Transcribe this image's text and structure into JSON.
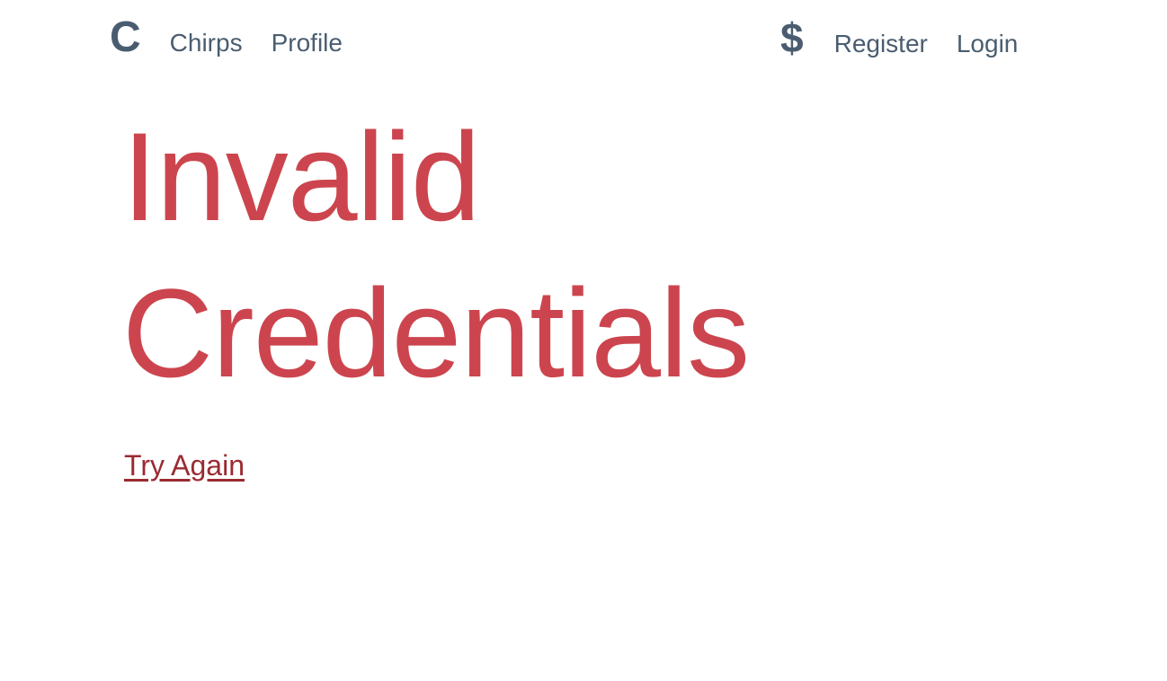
{
  "navbar": {
    "brand_left": "C",
    "links_left": [
      "Chirps",
      "Profile"
    ],
    "brand_right": "$",
    "links_right": [
      "Register",
      "Login"
    ]
  },
  "main": {
    "title_line1": "Invalid",
    "title_line2": "Credentials",
    "retry_label": "Try Again"
  },
  "colors": {
    "nav_text": "#4a5d70",
    "error_title": "#cc454e",
    "retry_link": "#9b2a31",
    "background": "#ffffff"
  }
}
